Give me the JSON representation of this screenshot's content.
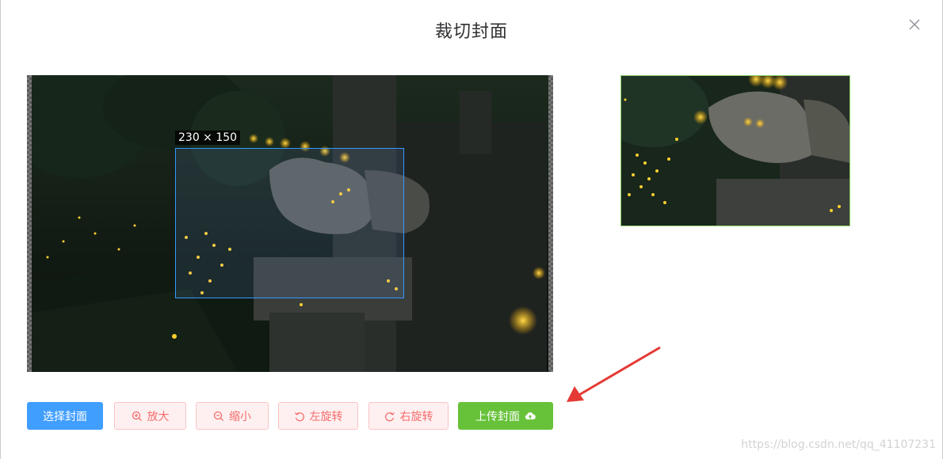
{
  "dialog": {
    "title": "裁切封面",
    "close_icon": "close-icon"
  },
  "cropper": {
    "size_label": "230 × 150"
  },
  "buttons": {
    "select": "选择封面",
    "zoom_in": "放大",
    "zoom_out": "缩小",
    "rotate_left": "左旋转",
    "rotate_right": "右旋转",
    "upload": "上传封面"
  },
  "icons": {
    "zoom_in": "zoom-in-icon",
    "zoom_out": "zoom-out-icon",
    "rotate_left": "rotate-left-icon",
    "rotate_right": "rotate-right-icon",
    "upload": "cloud-upload-icon"
  },
  "colors": {
    "primary": "#409eff",
    "danger": "#f56c6c",
    "success": "#67c23a",
    "arrow": "#e53935"
  },
  "watermark": "https://blog.csdn.net/qq_41107231"
}
